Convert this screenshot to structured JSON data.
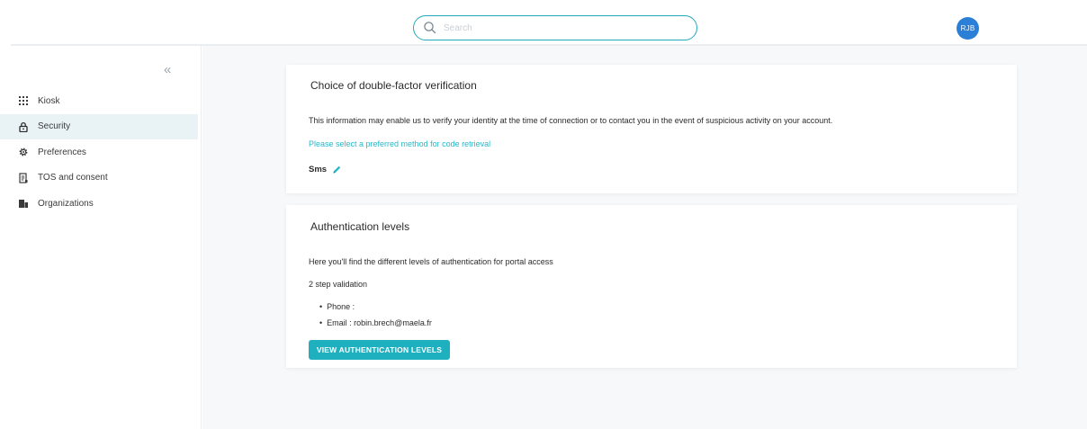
{
  "header": {
    "search_placeholder": "Search",
    "avatar_initials": "RJB"
  },
  "sidebar": {
    "collapse_glyph": "«",
    "items": [
      {
        "label": "Kiosk",
        "icon": "grid-icon"
      },
      {
        "label": "Security",
        "icon": "lock-icon",
        "active": true
      },
      {
        "label": "Preferences",
        "icon": "gear-icon"
      },
      {
        "label": "TOS and consent",
        "icon": "document-icon"
      },
      {
        "label": "Organizations",
        "icon": "building-icon"
      }
    ]
  },
  "double_factor": {
    "title": "Choice of double-factor verification",
    "description": "This information may enable us to verify your identity at the time of connection or to contact you in the event of suspicious activity on your account.",
    "select_prompt": "Please select a preferred method for code retrieval",
    "method": "Sms"
  },
  "auth_levels": {
    "title": "Authentication levels",
    "description": "Here you'll find the different levels of authentication for portal access",
    "validation_label": "2 step validation",
    "items": [
      "Phone :",
      "Email : robin.brech@maela.fr"
    ],
    "button_label": "VIEW AUTHENTICATION LEVELS"
  },
  "colors": {
    "accent": "#1fb0c0",
    "avatar": "#2b7fd6",
    "active_nav": "#e9f3f5",
    "background": "#f6f8fa"
  }
}
